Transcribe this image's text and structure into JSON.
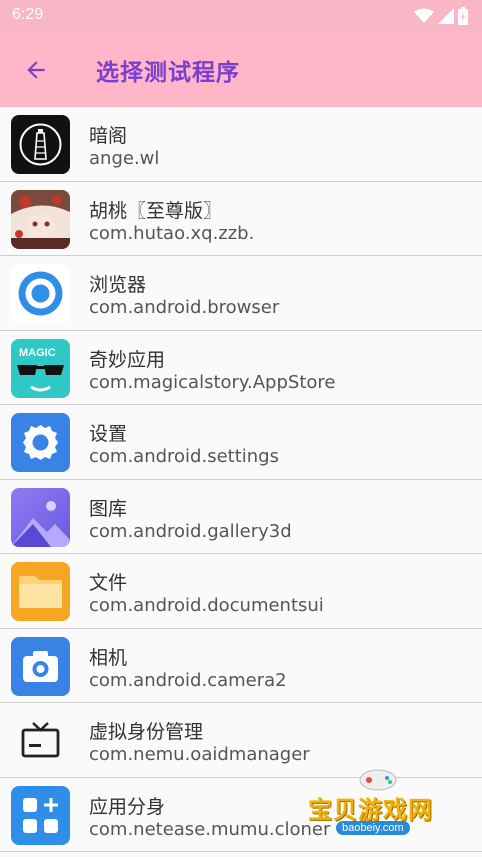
{
  "status_bar": {
    "time": "6:29",
    "icons": [
      "wifi-icon",
      "signal-icon",
      "battery-icon"
    ]
  },
  "app_bar": {
    "back_icon": "arrow-back-icon",
    "title": "选择测试程序",
    "background": "#ffb6c8",
    "title_color": "#7b3fcf"
  },
  "apps": [
    {
      "name": "暗阁",
      "package": "ange.wl",
      "icon": "lighthouse-icon"
    },
    {
      "name": "胡桃〖至尊版〗",
      "package": "com.hutao.xq.zzb.",
      "icon": "anime-avatar-icon"
    },
    {
      "name": "浏览器",
      "package": "com.android.browser",
      "icon": "browser-icon"
    },
    {
      "name": "奇妙应用",
      "package": "com.magicalstory.AppStore",
      "icon": "magic-sunglasses-icon"
    },
    {
      "name": "设置",
      "package": "com.android.settings",
      "icon": "settings-gear-icon"
    },
    {
      "name": "图库",
      "package": "com.android.gallery3d",
      "icon": "gallery-icon"
    },
    {
      "name": "文件",
      "package": "com.android.documentsui",
      "icon": "folder-icon"
    },
    {
      "name": "相机",
      "package": "com.android.camera2",
      "icon": "camera-icon"
    },
    {
      "name": "虚拟身份管理",
      "package": "com.nemu.oaidmanager",
      "icon": "tv-icon"
    },
    {
      "name": "应用分身",
      "package": "com.netease.mumu.cloner",
      "icon": "app-grid-plus-icon"
    }
  ],
  "watermark": {
    "text": "宝贝游戏网",
    "url": "baobeiy.com"
  }
}
